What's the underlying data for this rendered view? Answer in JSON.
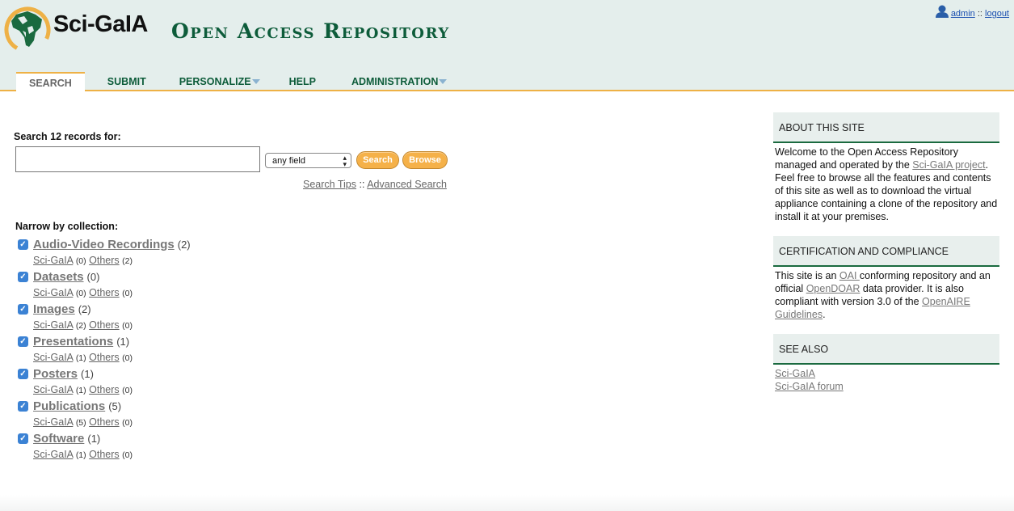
{
  "header": {
    "brand": "Sci-GaIA",
    "site_title": "Open Access Repository",
    "user": {
      "name": "admin",
      "separator": " :: ",
      "logout": "logout"
    }
  },
  "nav": [
    {
      "label": "SEARCH",
      "active": true,
      "has_menu": false
    },
    {
      "label": "SUBMIT",
      "active": false,
      "has_menu": false
    },
    {
      "label": "PERSONALIZE",
      "active": false,
      "has_menu": true
    },
    {
      "label": "HELP",
      "active": false,
      "has_menu": false
    },
    {
      "label": "ADMINISTRATION",
      "active": false,
      "has_menu": true
    }
  ],
  "search": {
    "label": "Search 12 records for:",
    "query": "",
    "field_selected": "any field",
    "search_button": "Search",
    "browse_button": "Browse",
    "tips_link": "Search Tips",
    "tips_separator": " :: ",
    "advanced_link": "Advanced Search"
  },
  "narrow": {
    "label": "Narrow by collection:",
    "collections": [
      {
        "name": "Audio-Video Recordings",
        "count": "(2)",
        "sub": [
          {
            "name": "Sci-GaIA",
            "count": "(0)"
          },
          {
            "name": "Others",
            "count": "(2)"
          }
        ]
      },
      {
        "name": "Datasets",
        "count": "(0)",
        "sub": [
          {
            "name": "Sci-GaIA",
            "count": "(0)"
          },
          {
            "name": "Others",
            "count": "(0)"
          }
        ]
      },
      {
        "name": "Images",
        "count": "(2)",
        "sub": [
          {
            "name": "Sci-GaIA",
            "count": "(2)"
          },
          {
            "name": "Others",
            "count": "(0)"
          }
        ]
      },
      {
        "name": "Presentations",
        "count": "(1)",
        "sub": [
          {
            "name": "Sci-GaIA",
            "count": "(1)"
          },
          {
            "name": "Others",
            "count": "(0)"
          }
        ]
      },
      {
        "name": "Posters",
        "count": "(1)",
        "sub": [
          {
            "name": "Sci-GaIA",
            "count": "(1)"
          },
          {
            "name": "Others",
            "count": "(0)"
          }
        ]
      },
      {
        "name": "Publications",
        "count": "(5)",
        "sub": [
          {
            "name": "Sci-GaIA",
            "count": "(5)"
          },
          {
            "name": "Others",
            "count": "(0)"
          }
        ]
      },
      {
        "name": "Software",
        "count": "(1)",
        "sub": [
          {
            "name": "Sci-GaIA",
            "count": "(1)"
          },
          {
            "name": "Others",
            "count": "(0)"
          }
        ]
      }
    ]
  },
  "sidebar": {
    "about": {
      "title": "ABOUT THIS SITE",
      "text_before": "Welcome to the Open Access Repository managed and operated by the ",
      "link": "Sci-GaIA project",
      "text_after": ". Feel free to browse all the features and contents of this site as well as to download the virtual appliance containing a clone of the repository and install it at your premises."
    },
    "certification": {
      "title": "CERTIFICATION AND COMPLIANCE",
      "t1": "This site is an ",
      "link1": "OAI ",
      "t2": "conforming repository and an official ",
      "link2": "OpenDOAR",
      "t3": " data provider. It is also compliant with version 3.0 of the ",
      "link3": "OpenAIRE Guidelines",
      "t4": "."
    },
    "see_also": {
      "title": "SEE ALSO",
      "links": [
        "Sci-GaIA",
        "Sci-GaIA forum"
      ]
    }
  },
  "colors": {
    "brand_green": "#0d5c3a",
    "accent_orange": "#eeb146",
    "header_bg": "#e4eeec",
    "checkbox_blue": "#3b82d4"
  }
}
